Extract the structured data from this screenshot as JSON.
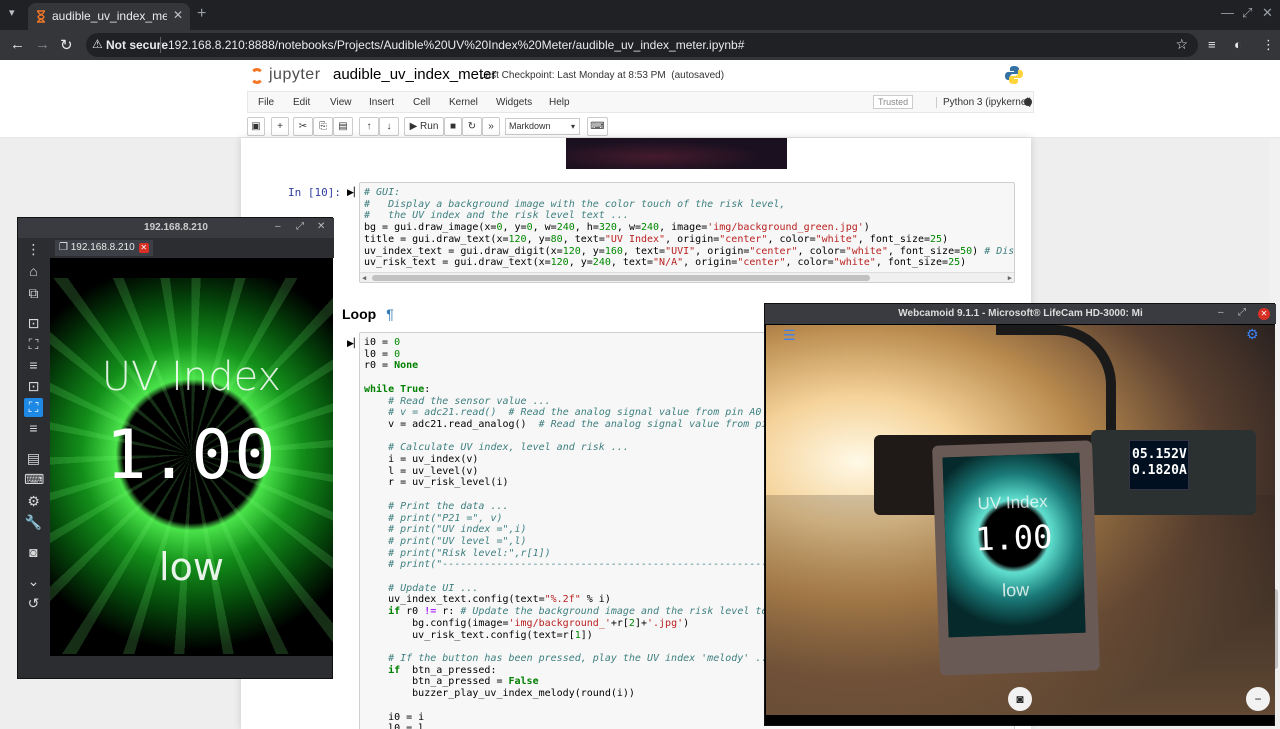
{
  "browser": {
    "tab_title": "audible_uv_index_meter",
    "new_tab": "+",
    "security_label": "Not secure",
    "url": "192.168.8.210:8888/notebooks/Projects/Audible%20UV%20Index%20Meter/audible_uv_index_meter.ipynb#"
  },
  "jupyter": {
    "logo_text": "jupyter",
    "notebook_name": "audible_uv_index_meter",
    "checkpoint": "Last Checkpoint: Last Monday at 8:53 PM",
    "autosaved": "(autosaved)",
    "menu": [
      "File",
      "Edit",
      "View",
      "Insert",
      "Cell",
      "Kernel",
      "Widgets",
      "Help"
    ],
    "trusted": "Trusted",
    "kernel": "Python 3 (ipykernel)",
    "run_label": "Run",
    "cell_type": "Markdown"
  },
  "cells": {
    "gui_prompt": "In [10]:",
    "loop_heading": "Loop",
    "pilcrow": "¶"
  },
  "emulator": {
    "window_title": "192.168.8.210",
    "tab_label": "192.168.8.210",
    "screen_title": "UV Index",
    "screen_value": "1.00",
    "screen_risk": "low"
  },
  "webcam": {
    "window_title": "Webcamoid 9.1.1 - Microsoft® LifeCam HD-3000: Mi",
    "meter_voltage": "05.152V",
    "meter_current": "0.1820A",
    "device_title": "UV Index",
    "device_value": "1.00",
    "device_risk": "low"
  },
  "colors": {
    "accent": "#1e88e5",
    "jupyter_orange": "#f37726",
    "prompt_blue": "#303f9f",
    "close_red": "#d93025"
  }
}
